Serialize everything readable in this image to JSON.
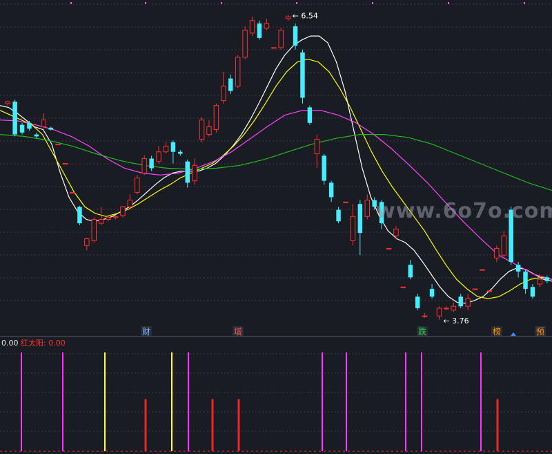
{
  "chart_data": {
    "type": "candlestick",
    "price_range": [
      3.4,
      6.65
    ],
    "candles": [
      [
        5.62,
        5.64,
        5.6,
        5.65
      ],
      [
        5.64,
        5.3,
        5.28,
        5.66
      ],
      [
        5.4,
        5.32,
        5.3,
        5.42
      ],
      [
        5.42,
        5.36,
        5.34,
        5.44
      ],
      [
        5.3,
        5.28,
        5.26,
        5.32
      ],
      [
        5.38,
        5.45,
        5.36,
        5.52
      ],
      [
        5.37,
        5.35,
        5.34,
        5.38
      ],
      [
        5.2,
        5.2,
        5.2,
        5.2
      ],
      [
        5.0,
        5.0,
        5.0,
        5.0
      ],
      [
        4.7,
        4.7,
        4.7,
        4.7
      ],
      [
        4.55,
        4.38,
        4.36,
        4.56
      ],
      [
        4.15,
        4.22,
        4.1,
        4.23
      ],
      [
        4.2,
        4.42,
        4.18,
        4.44
      ],
      [
        4.38,
        4.42,
        4.36,
        4.55
      ],
      [
        4.42,
        4.44,
        4.4,
        4.45
      ],
      [
        4.44,
        4.45,
        4.42,
        4.46
      ],
      [
        4.46,
        4.55,
        4.44,
        4.56
      ],
      [
        4.55,
        4.62,
        4.52,
        4.68
      ],
      [
        4.7,
        4.85,
        4.68,
        4.88
      ],
      [
        4.9,
        5.05,
        4.88,
        5.08
      ],
      [
        5.05,
        4.95,
        4.92,
        5.08
      ],
      [
        5.02,
        5.12,
        5.0,
        5.18
      ],
      [
        5.12,
        5.18,
        5.1,
        5.22
      ],
      [
        5.22,
        5.12,
        5.0,
        5.24
      ],
      [
        5.12,
        5.1,
        5.08,
        5.14
      ],
      [
        5.02,
        4.8,
        4.75,
        5.04
      ],
      [
        4.82,
        4.98,
        4.78,
        5.05
      ],
      [
        5.25,
        5.45,
        5.22,
        5.48
      ],
      [
        5.3,
        5.38,
        5.28,
        5.45
      ],
      [
        5.35,
        5.6,
        5.32,
        5.62
      ],
      [
        5.65,
        5.8,
        5.62,
        5.95
      ],
      [
        5.88,
        5.75,
        5.72,
        5.92
      ],
      [
        5.8,
        6.1,
        5.78,
        6.12
      ],
      [
        6.1,
        6.38,
        6.08,
        6.42
      ],
      [
        6.35,
        6.48,
        6.32,
        6.52
      ],
      [
        6.45,
        6.3,
        6.28,
        6.48
      ],
      [
        6.4,
        6.45,
        6.38,
        6.5
      ],
      [
        6.2,
        6.2,
        6.2,
        6.2
      ],
      [
        6.2,
        6.38,
        6.18,
        6.4
      ],
      [
        6.5,
        6.52,
        6.48,
        6.54
      ],
      [
        6.42,
        6.22,
        6.18,
        6.45
      ],
      [
        6.15,
        5.68,
        5.62,
        6.18
      ],
      [
        5.58,
        5.42,
        5.4,
        5.6
      ],
      [
        5.1,
        5.25,
        4.95,
        5.3
      ],
      [
        5.08,
        4.82,
        4.78,
        5.1
      ],
      [
        4.8,
        4.65,
        4.6,
        4.82
      ],
      [
        4.52,
        4.4,
        4.38,
        4.55
      ],
      [
        4.6,
        4.6,
        4.6,
        4.6
      ],
      [
        4.2,
        4.45,
        4.15,
        4.58
      ],
      [
        4.58,
        4.28,
        4.05,
        4.62
      ],
      [
        4.45,
        4.62,
        4.42,
        4.68
      ],
      [
        4.62,
        4.55,
        4.52,
        4.65
      ],
      [
        4.6,
        4.38,
        4.32,
        4.62
      ],
      [
        4.12,
        4.12,
        4.12,
        4.12
      ],
      [
        4.25,
        4.32,
        4.22,
        4.35
      ],
      [
        3.72,
        3.72,
        3.72,
        3.72
      ],
      [
        3.95,
        3.82,
        3.8,
        4.0
      ],
      [
        3.62,
        3.5,
        3.48,
        3.65
      ],
      [
        3.42,
        3.42,
        3.4,
        3.45
      ],
      [
        3.7,
        3.62,
        3.6,
        3.75
      ],
      [
        3.42,
        3.5,
        3.38,
        3.52
      ],
      [
        3.5,
        3.5,
        3.48,
        3.52
      ],
      [
        3.48,
        3.52,
        3.46,
        3.56
      ],
      [
        3.62,
        3.52,
        3.5,
        3.65
      ],
      [
        3.52,
        3.6,
        3.48,
        3.65
      ],
      [
        3.7,
        3.7,
        3.7,
        3.7
      ],
      [
        3.9,
        3.9,
        3.9,
        3.9
      ],
      [
        3.68,
        3.68,
        3.68,
        3.68
      ],
      [
        4.02,
        4.12,
        3.98,
        4.15
      ],
      [
        4.05,
        4.25,
        4.02,
        4.3
      ],
      [
        4.52,
        3.98,
        3.95,
        4.55
      ],
      [
        3.95,
        3.88,
        3.82,
        3.98
      ],
      [
        3.88,
        3.7,
        3.65,
        3.9
      ],
      [
        3.72,
        3.62,
        3.6,
        3.75
      ],
      [
        3.75,
        3.8,
        3.72,
        3.85
      ],
      [
        3.82,
        3.78,
        3.76,
        3.84
      ]
    ],
    "ma_series": [
      {
        "color": "#ffffff",
        "values": [
          5.6,
          5.58,
          5.52,
          5.45,
          5.38,
          5.35,
          5.2,
          4.9,
          4.65,
          4.5,
          4.42,
          4.4,
          4.42,
          4.45,
          4.5,
          4.55,
          4.62,
          4.7,
          4.78,
          4.85,
          4.9,
          4.92,
          4.92,
          4.92,
          4.95,
          5.0,
          5.08,
          5.18,
          5.3,
          5.45,
          5.62,
          5.8,
          5.98,
          6.12,
          6.22,
          6.28,
          6.32,
          6.32,
          6.25,
          6.05,
          5.75,
          5.35,
          4.95,
          4.65,
          4.45,
          4.3,
          4.22,
          4.18,
          4.1,
          3.98,
          3.85,
          3.72,
          3.62,
          3.56,
          3.55,
          3.58,
          3.62,
          3.7,
          3.8,
          3.88,
          3.92,
          3.9,
          3.85,
          3.8,
          3.78
        ]
      },
      {
        "color": "#ffff00",
        "values": [
          5.55,
          5.5,
          5.45,
          5.4,
          5.3,
          5.1,
          4.9,
          4.7,
          4.55,
          4.48,
          4.45,
          4.48,
          4.52,
          4.58,
          4.65,
          4.72,
          4.78,
          4.85,
          4.9,
          4.95,
          5.0,
          5.08,
          5.18,
          5.3,
          5.45,
          5.62,
          5.8,
          5.95,
          6.05,
          6.08,
          6.05,
          5.95,
          5.78,
          5.58,
          5.35,
          5.12,
          4.92,
          4.75,
          4.6,
          4.45,
          4.3,
          4.12,
          3.95,
          3.8,
          3.7,
          3.62,
          3.6,
          3.62,
          3.68,
          3.75,
          3.8,
          3.82,
          3.8
        ]
      },
      {
        "color": "#ff44ff",
        "values": [
          5.45,
          5.44,
          5.4,
          5.35,
          5.28,
          5.18,
          5.05,
          4.95,
          4.9,
          4.88,
          4.9,
          4.95,
          5.02,
          5.12,
          5.25,
          5.38,
          5.5,
          5.55,
          5.55,
          5.5,
          5.42,
          5.3,
          5.15,
          4.98,
          4.8,
          4.6,
          4.4,
          4.22,
          4.05,
          3.95,
          3.85,
          3.8
        ]
      },
      {
        "color": "#22bb22",
        "values": [
          5.3,
          5.28,
          5.24,
          5.18,
          5.1,
          5.03,
          4.98,
          4.95,
          4.94,
          4.95,
          4.98,
          5.04,
          5.12,
          5.2,
          5.26,
          5.3,
          5.3,
          5.27,
          5.2,
          5.1,
          5.0,
          4.9,
          4.8,
          4.72
        ]
      }
    ],
    "annotations": [
      {
        "text": "6.54",
        "type": "high"
      },
      {
        "text": "3.76",
        "type": "low"
      }
    ],
    "events": [
      {
        "label": "财",
        "color": "#6fb6ff"
      },
      {
        "label": "增",
        "color": "#ff5050"
      },
      {
        "label": "跌",
        "color": "#22dd44"
      },
      {
        "label": "榜",
        "color": "#ff9900"
      },
      {
        "label": "预",
        "color": "#ff9900"
      }
    ],
    "indicator": {
      "name": "红太阳",
      "value": "0.00",
      "axis_value": "0.00",
      "bars": [
        {
          "color": "#ff33ff",
          "h": 1.0
        },
        {
          "color": "#ff33ff",
          "h": 1.0
        },
        {
          "color": "#ffff33",
          "h": 1.0
        },
        {
          "color": "#ff2020",
          "h": 0.53
        },
        {
          "color": "#ffff33",
          "h": 1.0
        },
        {
          "color": "#ff33ff",
          "h": 1.0
        },
        {
          "color": "#ff2020",
          "h": 0.53
        },
        {
          "color": "#ff2020",
          "h": 0.53
        },
        {
          "color": "#ff33ff",
          "h": 1.0
        },
        {
          "color": "#ff33ff",
          "h": 1.0
        },
        {
          "color": "#ff33ff",
          "h": 1.0
        },
        {
          "color": "#ff33ff",
          "h": 1.0
        },
        {
          "color": "#ff33ff",
          "h": 1.0
        },
        {
          "color": "#ff2020",
          "h": 0.53
        }
      ]
    }
  },
  "watermark": "www.6o7o.com",
  "colors": {
    "up": "#ff3030",
    "down": "#44eeff",
    "grid": "#3a3d4a",
    "bg": "#1a1c24"
  }
}
